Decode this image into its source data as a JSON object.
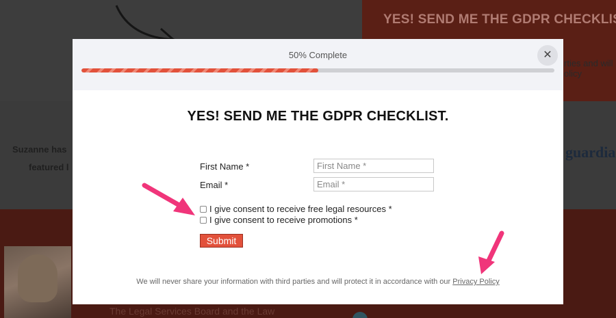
{
  "background": {
    "heading": "YES! SEND ME THE GDPR CHECKLIST",
    "right_text_1": "rties and will",
    "right_text_2": "olicy",
    "left_text_1": "Suzanne has",
    "left_text_2": "featured l",
    "guardian": "guardia",
    "bottom_text": "The Legal Services Board and the Law"
  },
  "modal": {
    "progress": {
      "label": "50% Complete",
      "value": 0.5,
      "fill_color": "#e2513b"
    },
    "close_icon": "close-icon",
    "title": "YES! SEND ME THE GDPR CHECKLIST.",
    "form": {
      "first_name_label": "First Name *",
      "first_name_placeholder": "First Name *",
      "first_name_value": "",
      "email_label": "Email *",
      "email_placeholder": "Email *",
      "email_value": "",
      "consent_resources": "I give consent to receive free legal resources *",
      "consent_promotions": "I give consent to receive promotions *",
      "submit_label": "Submit"
    },
    "privacy": {
      "text": "We will never share your information with third parties and will protect it in accordance with our ",
      "link": "Privacy Policy"
    }
  },
  "annotations": {
    "arrow_color": "#f0357a"
  }
}
